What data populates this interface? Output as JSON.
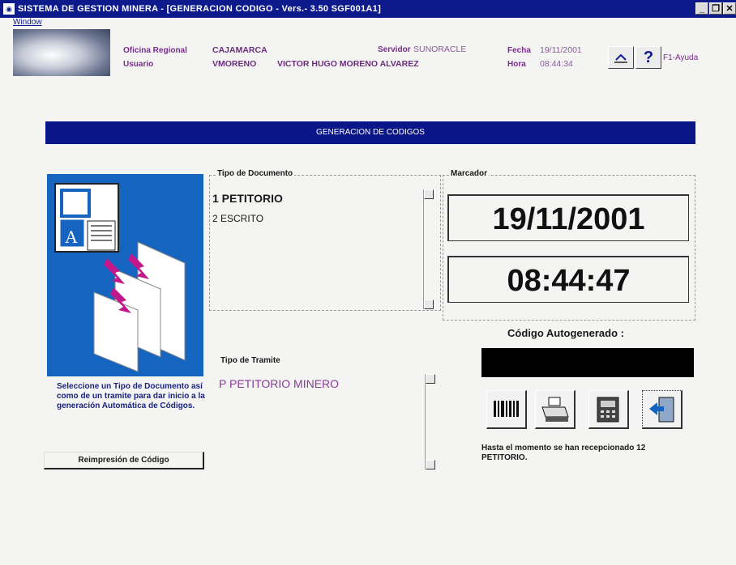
{
  "window": {
    "title": "SISTEMA DE GESTION MINERA - [GENERACION CODIGO - Vers.- 3.50 SGF001A1]",
    "controls": [
      "_",
      "B",
      "X"
    ]
  },
  "menu": {
    "window": "Window"
  },
  "header": {
    "oficina_label": "Oficina Regional",
    "oficina_value": "CAJAMARCA",
    "usuario_label": "Usuario",
    "usuario_code": "VMORENO",
    "usuario_name": "VICTOR HUGO MORENO ALVAREZ",
    "servidor_label": "Servidor",
    "servidor_value": "SUNORACLE",
    "fecha_label": "Fecha",
    "fecha_value": "19/11/2001",
    "hora_label": "Hora",
    "hora_value": "08:44:34",
    "help_text": "F1-Ayuda"
  },
  "banner": {
    "title": "GENERACION DE CODIGOS"
  },
  "tipo_documento": {
    "title": "Tipo de Documento",
    "items": [
      "1 PETITORIO",
      "2 ESCRITO"
    ]
  },
  "tipo_tramite": {
    "title": "Tipo de Tramite",
    "items": [
      "P PETITORIO MINERO"
    ]
  },
  "marcador": {
    "title": "Marcador",
    "fecha": "19/11/2001",
    "hora": "08:44:47"
  },
  "codigo": {
    "label": "Código Autogenerado :"
  },
  "instructions": "Seleccione un Tipo de Documento así como de un tramite para dar inicio a la generación Automática de Códigos.",
  "reprint_button": "Reimpresión de Código",
  "status": "Hasta el momento se han recepcionado 12 PETITORIO.",
  "colors": {
    "titlebar": "#0c1a8c",
    "banner": "#0a1687",
    "illustration": "#1565c0",
    "accent_purple": "#7a2c8f"
  }
}
